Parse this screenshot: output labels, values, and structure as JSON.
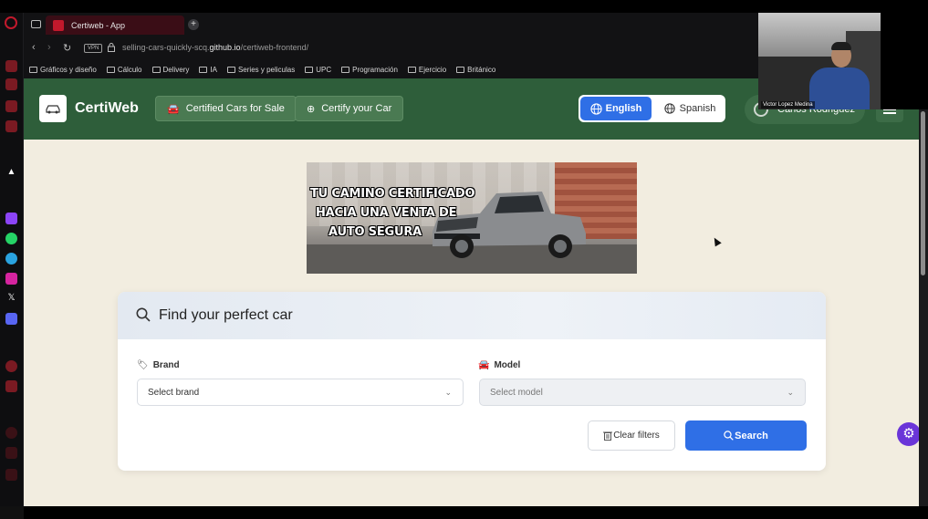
{
  "browser": {
    "tab_title": "Certiweb - App",
    "new_tab_label": "+",
    "url_prefix": "selling-cars-quickly-scq.",
    "url_domain": "github.io",
    "url_path": "/certiweb-frontend/",
    "vpn_badge": "VPN",
    "bookmarks": [
      "Gráficos y diseño",
      "Cálculo",
      "Delivery",
      "IA",
      "Series y peliculas",
      "UPC",
      "Programación",
      "Ejercicio",
      "Británico"
    ]
  },
  "header": {
    "logo_text": "CertiWeb",
    "brand": "CertiWeb",
    "nav": {
      "certified_cars": "Certified Cars for Sale",
      "certify_car": "Certify your Car"
    },
    "lang": {
      "english": "English",
      "spanish": "Spanish"
    },
    "user_name": "Carlos Rodriguez"
  },
  "banner": {
    "line1": "TU CAMINO CERTIFICADO",
    "line2": "HACIA UNA VENTA DE",
    "line3": "AUTO SEGURA"
  },
  "search_card": {
    "title": "Find your perfect car",
    "brand_label": "Brand",
    "brand_placeholder": "Select brand",
    "model_label": "Model",
    "model_placeholder": "Select model",
    "clear_label": "Clear filters",
    "search_label": "Search"
  },
  "webcam": {
    "name": "Victor Lopez Medina"
  },
  "colors": {
    "header_green": "#2e5e3a",
    "page_bg": "#f2ede0",
    "accent_blue": "#2f6fe6",
    "fab_purple": "#6a35d8"
  }
}
